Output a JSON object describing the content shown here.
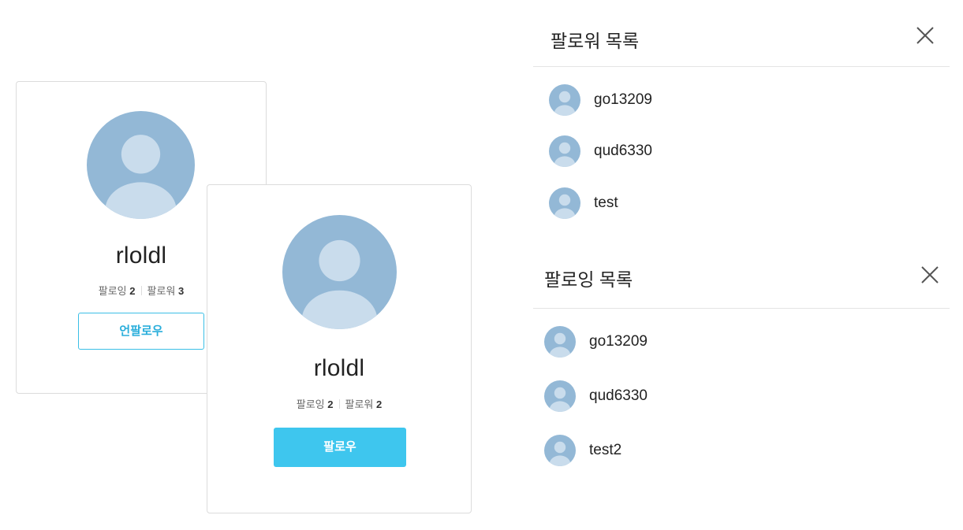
{
  "profile_cards": [
    {
      "username": "rloldl",
      "following_label": "팔로잉",
      "following_count": "2",
      "followers_label": "팔로워",
      "followers_count": "3",
      "action_label": "언팔로우"
    },
    {
      "username": "rloldl",
      "following_label": "팔로잉",
      "following_count": "2",
      "followers_label": "팔로워",
      "followers_count": "2",
      "action_label": "팔로우"
    }
  ],
  "followers_panel": {
    "title": "팔로워 목록",
    "close_icon": "close-icon",
    "users": [
      "go13209",
      "qud6330",
      "test"
    ]
  },
  "following_panel": {
    "title": "팔로잉 목록",
    "close_icon": "close-icon",
    "users": [
      "go13209",
      "qud6330",
      "test2"
    ]
  },
  "colors": {
    "accent": "#3ec6ee",
    "avatar_bg": "#93b8d6",
    "avatar_fg": "#c9dcec"
  }
}
